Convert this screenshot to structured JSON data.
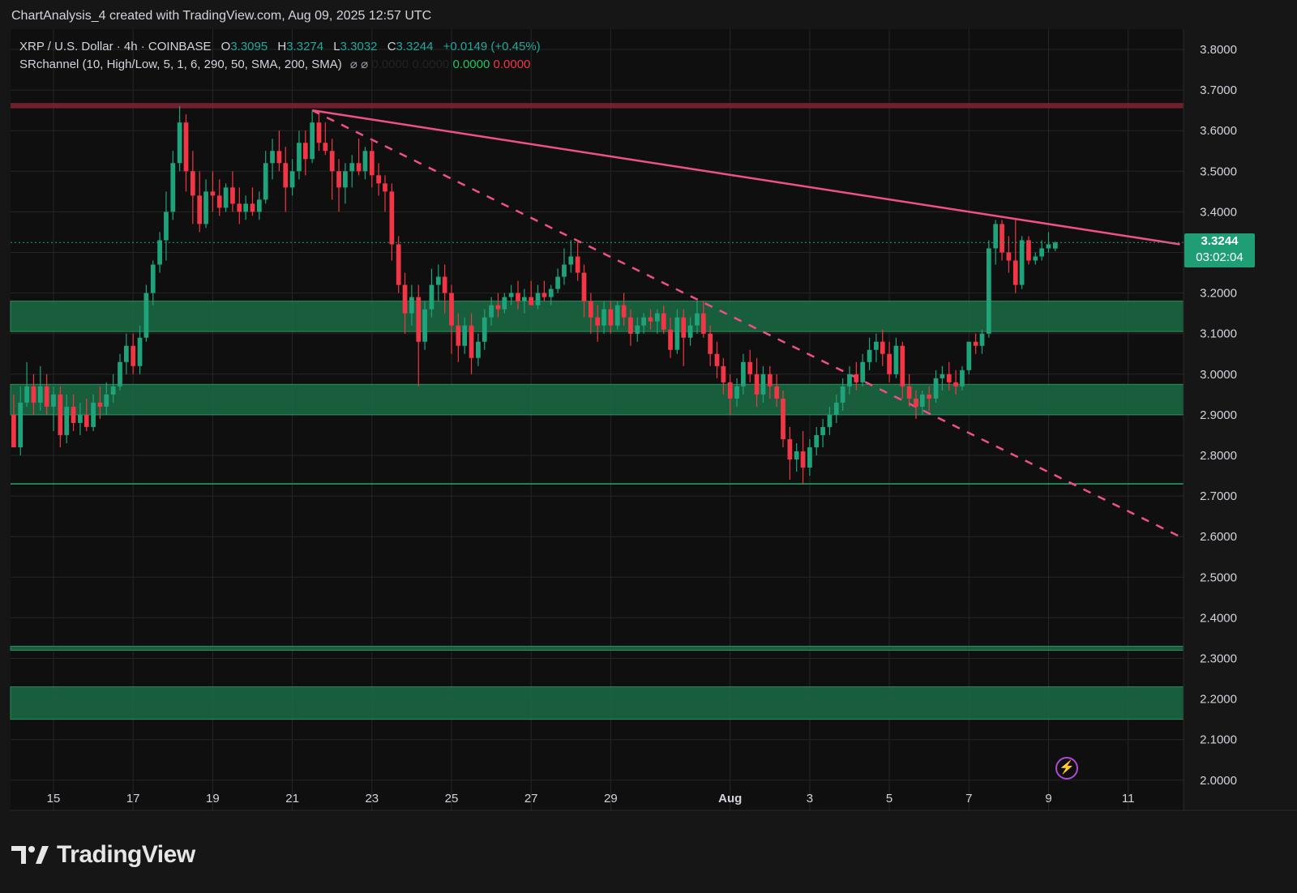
{
  "header": {
    "text": "ChartAnalysis_4 created with TradingView.com, Aug 09, 2025 12:57 UTC"
  },
  "legend": {
    "symbol": "XRP / U.S. Dollar · 4h · COINBASE",
    "open_label": "O",
    "open": "3.3095",
    "high_label": "H",
    "high": "3.3274",
    "low_label": "L",
    "low": "3.3032",
    "close_label": "C",
    "close": "3.3244",
    "change": "+0.0149 (+0.45%)",
    "indicator": "SRchannel (10, High/Low, 5, 1, 6, 290, 50, SMA, 200, SMA)",
    "indicator_icons": "⌀ ⌀",
    "ind_v1": "0.0000",
    "ind_v2": "0.0000",
    "ind_v3": "0.0000",
    "ind_v4": "0.0000"
  },
  "price_label": {
    "price": "3.3244",
    "countdown": "03:02:04"
  },
  "brand": {
    "name": "TradingView",
    "icon": "tradingview-logo-icon"
  },
  "icons": {
    "lightning": "lightning-icon"
  },
  "colors": {
    "bg": "#161616",
    "grid": "#262626",
    "up": "#1fa37a",
    "down": "#f23645",
    "trend": "#f0508a",
    "zone": "#1a6b45",
    "zone_border": "#2fa36b",
    "resistance": "#7a2230"
  },
  "chart_data": {
    "type": "candlestick",
    "ylim": [
      2.0,
      3.85
    ],
    "y_ticks": [
      "3.8000",
      "3.7000",
      "3.6000",
      "3.5000",
      "3.4000",
      "3.3000",
      "3.2000",
      "3.1000",
      "3.0000",
      "2.9000",
      "2.8000",
      "2.7000",
      "2.6000",
      "2.5000",
      "2.4000",
      "2.3000",
      "2.2000",
      "2.1000",
      "2.0000"
    ],
    "x_ticks": [
      {
        "label": "15",
        "day": 15
      },
      {
        "label": "17",
        "day": 17
      },
      {
        "label": "19",
        "day": 19
      },
      {
        "label": "21",
        "day": 21
      },
      {
        "label": "23",
        "day": 23
      },
      {
        "label": "25",
        "day": 25
      },
      {
        "label": "27",
        "day": 27
      },
      {
        "label": "29",
        "day": 29
      },
      {
        "label": "Aug",
        "day": 32
      },
      {
        "label": "3",
        "day": 34
      },
      {
        "label": "5",
        "day": 36
      },
      {
        "label": "7",
        "day": 38
      },
      {
        "label": "9",
        "day": 40
      },
      {
        "label": "11",
        "day": 42
      }
    ],
    "x_range_days": [
      13.9,
      43.5
    ],
    "last_price": 3.3244,
    "resistance_zone": [
      3.655,
      3.668
    ],
    "support_zones": [
      [
        3.105,
        3.18
      ],
      [
        2.9,
        2.975
      ],
      [
        2.32,
        2.33
      ],
      [
        2.15,
        2.23
      ]
    ],
    "support_line": 2.73,
    "trendline_solid": {
      "from": [
        21.5,
        3.65
      ],
      "to": [
        43.3,
        3.32
      ]
    },
    "trendline_dashed": {
      "from": [
        21.5,
        3.65
      ],
      "to": [
        43.3,
        2.6
      ]
    },
    "candles": [
      [
        14.0,
        2.9,
        2.95,
        2.82,
        2.82
      ],
      [
        14.17,
        2.82,
        2.97,
        2.8,
        2.93
      ],
      [
        14.33,
        2.93,
        3.03,
        2.92,
        2.97
      ],
      [
        14.5,
        2.97,
        3.0,
        2.9,
        2.93
      ],
      [
        14.67,
        2.93,
        3.02,
        2.91,
        2.97
      ],
      [
        14.83,
        2.97,
        3.0,
        2.9,
        2.92
      ],
      [
        15.0,
        2.92,
        2.97,
        2.86,
        2.95
      ],
      [
        15.17,
        2.95,
        2.97,
        2.82,
        2.85
      ],
      [
        15.33,
        2.85,
        2.95,
        2.83,
        2.92
      ],
      [
        15.5,
        2.92,
        2.95,
        2.86,
        2.88
      ],
      [
        15.67,
        2.88,
        2.93,
        2.85,
        2.9
      ],
      [
        15.83,
        2.9,
        2.94,
        2.86,
        2.87
      ],
      [
        16.0,
        2.87,
        2.95,
        2.86,
        2.93
      ],
      [
        16.17,
        2.93,
        2.97,
        2.89,
        2.92
      ],
      [
        16.33,
        2.92,
        2.98,
        2.9,
        2.95
      ],
      [
        16.5,
        2.95,
        3.0,
        2.93,
        2.97
      ],
      [
        16.67,
        2.97,
        3.05,
        2.96,
        3.03
      ],
      [
        16.83,
        3.03,
        3.1,
        3.0,
        3.07
      ],
      [
        17.0,
        3.07,
        3.1,
        3.0,
        3.02
      ],
      [
        17.17,
        3.02,
        3.12,
        3.0,
        3.09
      ],
      [
        17.33,
        3.09,
        3.22,
        3.08,
        3.2
      ],
      [
        17.5,
        3.2,
        3.28,
        3.17,
        3.27
      ],
      [
        17.67,
        3.27,
        3.35,
        3.25,
        3.33
      ],
      [
        17.83,
        3.33,
        3.45,
        3.28,
        3.4
      ],
      [
        18.0,
        3.4,
        3.55,
        3.38,
        3.52
      ],
      [
        18.17,
        3.52,
        3.66,
        3.5,
        3.62
      ],
      [
        18.33,
        3.62,
        3.64,
        3.45,
        3.5
      ],
      [
        18.5,
        3.5,
        3.55,
        3.37,
        3.44
      ],
      [
        18.67,
        3.44,
        3.5,
        3.35,
        3.37
      ],
      [
        18.83,
        3.37,
        3.48,
        3.36,
        3.45
      ],
      [
        19.0,
        3.45,
        3.5,
        3.4,
        3.44
      ],
      [
        19.17,
        3.44,
        3.48,
        3.39,
        3.41
      ],
      [
        19.33,
        3.41,
        3.47,
        3.4,
        3.46
      ],
      [
        19.5,
        3.46,
        3.5,
        3.4,
        3.42
      ],
      [
        19.67,
        3.42,
        3.46,
        3.37,
        3.4
      ],
      [
        19.83,
        3.4,
        3.44,
        3.38,
        3.42
      ],
      [
        20.0,
        3.42,
        3.46,
        3.39,
        3.4
      ],
      [
        20.17,
        3.4,
        3.45,
        3.38,
        3.43
      ],
      [
        20.33,
        3.43,
        3.55,
        3.42,
        3.52
      ],
      [
        20.5,
        3.52,
        3.58,
        3.48,
        3.55
      ],
      [
        20.67,
        3.55,
        3.6,
        3.5,
        3.52
      ],
      [
        20.83,
        3.52,
        3.56,
        3.4,
        3.46
      ],
      [
        21.0,
        3.46,
        3.53,
        3.44,
        3.5
      ],
      [
        21.17,
        3.5,
        3.6,
        3.48,
        3.57
      ],
      [
        21.33,
        3.57,
        3.6,
        3.49,
        3.53
      ],
      [
        21.5,
        3.53,
        3.65,
        3.52,
        3.62
      ],
      [
        21.67,
        3.62,
        3.64,
        3.55,
        3.57
      ],
      [
        21.83,
        3.57,
        3.62,
        3.54,
        3.55
      ],
      [
        22.0,
        3.55,
        3.58,
        3.43,
        3.5
      ],
      [
        22.17,
        3.5,
        3.53,
        3.4,
        3.46
      ],
      [
        22.33,
        3.46,
        3.52,
        3.42,
        3.5
      ],
      [
        22.5,
        3.5,
        3.54,
        3.46,
        3.52
      ],
      [
        22.67,
        3.52,
        3.58,
        3.49,
        3.5
      ],
      [
        22.83,
        3.5,
        3.56,
        3.48,
        3.55
      ],
      [
        23.0,
        3.55,
        3.58,
        3.46,
        3.49
      ],
      [
        23.17,
        3.49,
        3.52,
        3.44,
        3.47
      ],
      [
        23.33,
        3.47,
        3.49,
        3.4,
        3.45
      ],
      [
        23.5,
        3.45,
        3.47,
        3.28,
        3.32
      ],
      [
        23.67,
        3.32,
        3.34,
        3.2,
        3.22
      ],
      [
        23.83,
        3.22,
        3.25,
        3.1,
        3.15
      ],
      [
        24.0,
        3.15,
        3.22,
        3.12,
        3.19
      ],
      [
        24.17,
        3.19,
        3.22,
        2.97,
        3.08
      ],
      [
        24.33,
        3.08,
        3.18,
        3.06,
        3.16
      ],
      [
        24.5,
        3.16,
        3.26,
        3.14,
        3.22
      ],
      [
        24.67,
        3.22,
        3.27,
        3.18,
        3.24
      ],
      [
        24.83,
        3.24,
        3.27,
        3.15,
        3.2
      ],
      [
        25.0,
        3.2,
        3.22,
        3.05,
        3.12
      ],
      [
        25.17,
        3.12,
        3.15,
        3.03,
        3.07
      ],
      [
        25.33,
        3.07,
        3.14,
        3.05,
        3.12
      ],
      [
        25.5,
        3.12,
        3.15,
        3.0,
        3.04
      ],
      [
        25.67,
        3.04,
        3.1,
        3.02,
        3.08
      ],
      [
        25.83,
        3.08,
        3.16,
        3.06,
        3.14
      ],
      [
        26.0,
        3.14,
        3.19,
        3.12,
        3.17
      ],
      [
        26.17,
        3.17,
        3.2,
        3.14,
        3.16
      ],
      [
        26.33,
        3.16,
        3.2,
        3.15,
        3.19
      ],
      [
        26.5,
        3.19,
        3.22,
        3.17,
        3.2
      ],
      [
        26.67,
        3.2,
        3.23,
        3.16,
        3.18
      ],
      [
        26.83,
        3.18,
        3.21,
        3.15,
        3.19
      ],
      [
        27.0,
        3.19,
        3.23,
        3.17,
        3.17
      ],
      [
        27.17,
        3.17,
        3.22,
        3.16,
        3.2
      ],
      [
        27.33,
        3.2,
        3.23,
        3.18,
        3.19
      ],
      [
        27.5,
        3.19,
        3.22,
        3.17,
        3.21
      ],
      [
        27.67,
        3.21,
        3.26,
        3.2,
        3.24
      ],
      [
        27.83,
        3.24,
        3.31,
        3.22,
        3.27
      ],
      [
        28.0,
        3.27,
        3.33,
        3.25,
        3.29
      ],
      [
        28.17,
        3.29,
        3.33,
        3.23,
        3.25
      ],
      [
        28.33,
        3.25,
        3.27,
        3.14,
        3.18
      ],
      [
        28.5,
        3.18,
        3.2,
        3.1,
        3.14
      ],
      [
        28.67,
        3.14,
        3.17,
        3.08,
        3.12
      ],
      [
        28.83,
        3.12,
        3.18,
        3.1,
        3.16
      ],
      [
        29.0,
        3.16,
        3.18,
        3.1,
        3.12
      ],
      [
        29.17,
        3.12,
        3.18,
        3.11,
        3.17
      ],
      [
        29.33,
        3.17,
        3.2,
        3.12,
        3.14
      ],
      [
        29.5,
        3.14,
        3.16,
        3.07,
        3.1
      ],
      [
        29.67,
        3.1,
        3.14,
        3.08,
        3.12
      ],
      [
        29.83,
        3.12,
        3.15,
        3.1,
        3.14
      ],
      [
        30.0,
        3.14,
        3.16,
        3.11,
        3.13
      ],
      [
        30.17,
        3.13,
        3.16,
        3.1,
        3.15
      ],
      [
        30.33,
        3.15,
        3.17,
        3.1,
        3.11
      ],
      [
        30.5,
        3.11,
        3.14,
        3.04,
        3.06
      ],
      [
        30.67,
        3.06,
        3.16,
        3.05,
        3.14
      ],
      [
        30.83,
        3.14,
        3.16,
        3.02,
        3.09
      ],
      [
        31.0,
        3.09,
        3.14,
        3.07,
        3.12
      ],
      [
        31.17,
        3.12,
        3.18,
        3.1,
        3.15
      ],
      [
        31.33,
        3.15,
        3.18,
        3.09,
        3.1
      ],
      [
        31.5,
        3.1,
        3.12,
        3.02,
        3.05
      ],
      [
        31.67,
        3.05,
        3.08,
        2.99,
        3.02
      ],
      [
        31.83,
        3.02,
        3.04,
        2.95,
        2.98
      ],
      [
        32.0,
        2.98,
        3.0,
        2.9,
        2.94
      ],
      [
        32.17,
        2.94,
        2.99,
        2.92,
        2.97
      ],
      [
        32.33,
        2.97,
        3.05,
        2.95,
        3.03
      ],
      [
        32.5,
        3.03,
        3.06,
        2.98,
        3.0
      ],
      [
        32.67,
        3.0,
        3.04,
        2.92,
        2.95
      ],
      [
        32.83,
        2.95,
        3.02,
        2.93,
        3.0
      ],
      [
        33.0,
        3.0,
        3.02,
        2.94,
        2.97
      ],
      [
        33.17,
        2.97,
        3.0,
        2.92,
        2.94
      ],
      [
        33.33,
        2.94,
        2.96,
        2.82,
        2.84
      ],
      [
        33.5,
        2.84,
        2.87,
        2.74,
        2.79
      ],
      [
        33.67,
        2.79,
        2.83,
        2.76,
        2.81
      ],
      [
        33.83,
        2.81,
        2.86,
        2.73,
        2.77
      ],
      [
        34.0,
        2.77,
        2.84,
        2.75,
        2.82
      ],
      [
        34.17,
        2.82,
        2.87,
        2.8,
        2.85
      ],
      [
        34.33,
        2.85,
        2.89,
        2.82,
        2.87
      ],
      [
        34.5,
        2.87,
        2.92,
        2.85,
        2.9
      ],
      [
        34.67,
        2.9,
        2.95,
        2.88,
        2.93
      ],
      [
        34.83,
        2.93,
        2.99,
        2.91,
        2.97
      ],
      [
        35.0,
        2.97,
        3.02,
        2.95,
        3.0
      ],
      [
        35.17,
        3.0,
        3.03,
        2.96,
        2.98
      ],
      [
        35.33,
        2.98,
        3.05,
        2.97,
        3.03
      ],
      [
        35.5,
        3.03,
        3.09,
        3.01,
        3.06
      ],
      [
        35.67,
        3.06,
        3.1,
        3.03,
        3.08
      ],
      [
        35.83,
        3.08,
        3.11,
        3.02,
        3.05
      ],
      [
        36.0,
        3.05,
        3.08,
        2.98,
        3.0
      ],
      [
        36.17,
        3.0,
        3.09,
        2.99,
        3.07
      ],
      [
        36.33,
        3.07,
        3.08,
        2.94,
        2.97
      ],
      [
        36.5,
        2.97,
        3.0,
        2.92,
        2.94
      ],
      [
        36.67,
        2.94,
        2.96,
        2.89,
        2.92
      ],
      [
        36.83,
        2.92,
        2.96,
        2.9,
        2.95
      ],
      [
        37.0,
        2.95,
        2.97,
        2.91,
        2.94
      ],
      [
        37.17,
        2.94,
        3.01,
        2.93,
        2.99
      ],
      [
        37.33,
        2.99,
        3.02,
        2.96,
        3.0
      ],
      [
        37.5,
        3.0,
        3.03,
        2.96,
        2.98
      ],
      [
        37.67,
        2.98,
        3.01,
        2.95,
        2.97
      ],
      [
        37.83,
        2.97,
        3.02,
        2.96,
        3.01
      ],
      [
        38.0,
        3.01,
        3.07,
        3.0,
        3.08
      ],
      [
        38.17,
        3.08,
        3.1,
        3.05,
        3.07
      ],
      [
        38.33,
        3.07,
        3.11,
        3.05,
        3.1
      ],
      [
        38.5,
        3.1,
        3.33,
        3.09,
        3.31
      ],
      [
        38.67,
        3.31,
        3.38,
        3.27,
        3.37
      ],
      [
        38.83,
        3.37,
        3.38,
        3.28,
        3.3
      ],
      [
        39.0,
        3.3,
        3.34,
        3.25,
        3.28
      ],
      [
        39.17,
        3.28,
        3.38,
        3.2,
        3.22
      ],
      [
        39.33,
        3.22,
        3.34,
        3.21,
        3.33
      ],
      [
        39.5,
        3.33,
        3.34,
        3.27,
        3.28
      ],
      [
        39.67,
        3.28,
        3.3,
        3.27,
        3.29
      ],
      [
        39.83,
        3.29,
        3.33,
        3.28,
        3.31
      ],
      [
        40.0,
        3.31,
        3.35,
        3.3,
        3.32
      ],
      [
        40.17,
        3.3095,
        3.3274,
        3.3032,
        3.3244
      ]
    ]
  }
}
